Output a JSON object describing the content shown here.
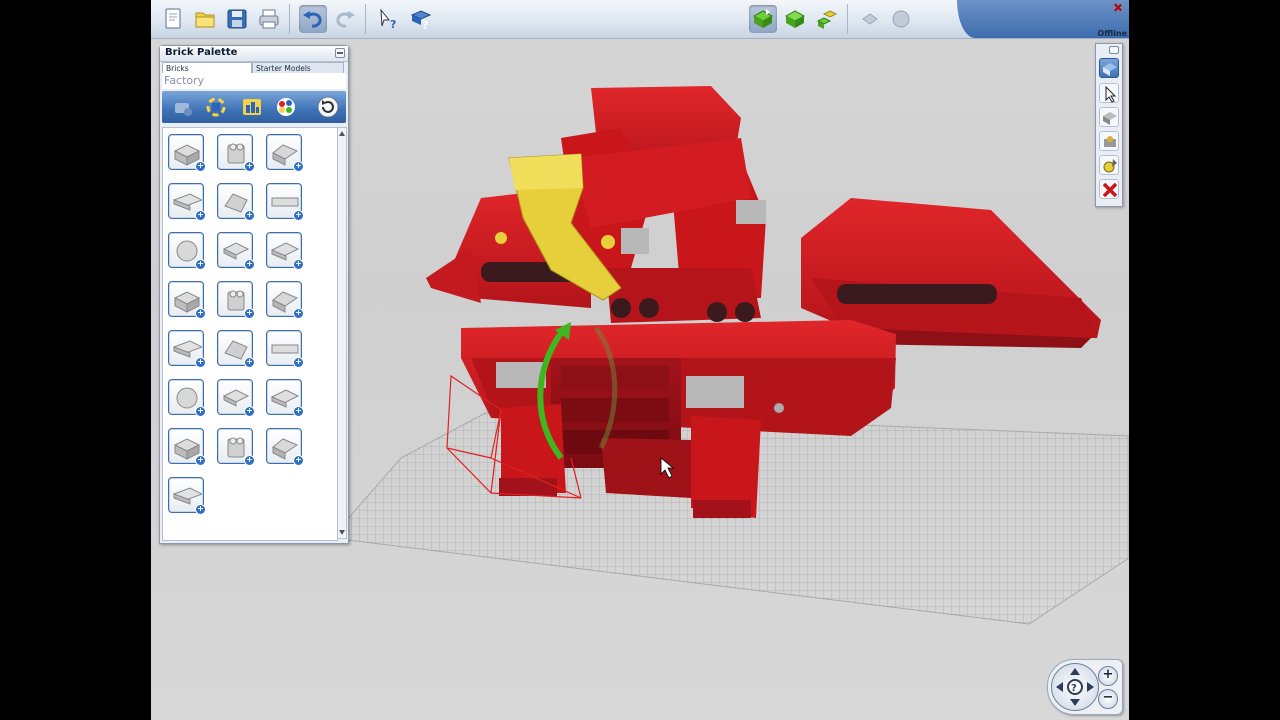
{
  "window": {
    "status": "Offline"
  },
  "toolbar": {
    "buttons": [
      {
        "name": "new-file-icon"
      },
      {
        "name": "open-folder-icon"
      },
      {
        "name": "save-icon"
      },
      {
        "name": "print-icon"
      },
      {
        "name": "undo-icon"
      },
      {
        "name": "redo-icon"
      },
      {
        "name": "select-help-icon"
      },
      {
        "name": "brick-help-icon"
      },
      {
        "name": "build-mode-icon"
      },
      {
        "name": "view-mode-icon"
      },
      {
        "name": "building-guide-icon"
      },
      {
        "name": "share-icon"
      },
      {
        "name": "community-icon"
      }
    ]
  },
  "palette": {
    "title": "Brick Palette",
    "tabs": [
      {
        "label": "Bricks",
        "active": true
      },
      {
        "label": "Starter Models",
        "active": false
      }
    ],
    "subtitle": "Factory",
    "icons": [
      "add-brick-icon",
      "recolor-icon",
      "sort-icon",
      "color-palette-icon",
      "refresh-icon"
    ],
    "bricks": [
      "brick-2x2-icon",
      "brick-1x2-round-icon",
      "brick-2x2-slope-icon",
      "plate-2x4-icon",
      "slope-brick-icon",
      "tile-1x4-icon",
      "round-brick-icon",
      "plate-2x2-icon",
      "plate-2x3-icon",
      "plate-2x2b-icon",
      "hinge-plate-icon",
      "clip-brick-icon",
      "door-panel-icon",
      "gear-wheel-icon",
      "lever-icon",
      "minifig-icon",
      "technic-beam-icon",
      "plate-1x4-icon",
      "plate-angled-icon",
      "gear-small-icon",
      "round-tile-icon",
      "baseplate-icon"
    ]
  },
  "tools": {
    "buttons": [
      "brick-select-icon",
      "pointer-icon",
      "clone-icon",
      "hinge-tool-icon",
      "paint-icon",
      "delete-icon"
    ]
  },
  "colors": {
    "accent": "#3e72b6",
    "model_red": "#c8161b",
    "model_yellow": "#e6cf3a",
    "selection_green": "#3fb51f"
  }
}
